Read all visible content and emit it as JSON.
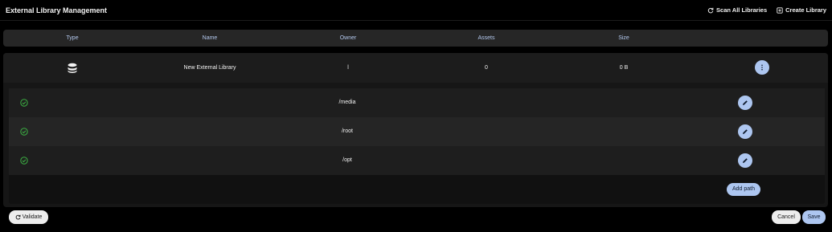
{
  "header": {
    "title": "External Library Management",
    "scan_label": "Scan All Libraries",
    "create_label": "Create Library"
  },
  "table": {
    "columns": [
      "Type",
      "Name",
      "Owner",
      "Assets",
      "Size"
    ]
  },
  "library": {
    "type_icon": "database-icon",
    "name": "New External Library",
    "owner": "l",
    "assets": "0",
    "size": "0 B"
  },
  "paths": [
    {
      "status_icon": "check-circle-icon",
      "path": "/media"
    },
    {
      "status_icon": "check-circle-icon",
      "path": "/root"
    },
    {
      "status_icon": "check-circle-icon",
      "path": "/opt"
    }
  ],
  "actions": {
    "add_path_label": "Add path",
    "validate_label": "Validate",
    "cancel_label": "Cancel",
    "save_label": "Save"
  },
  "colors": {
    "accent": "#adc6f0",
    "success": "#3cb043",
    "background": "#000000"
  }
}
